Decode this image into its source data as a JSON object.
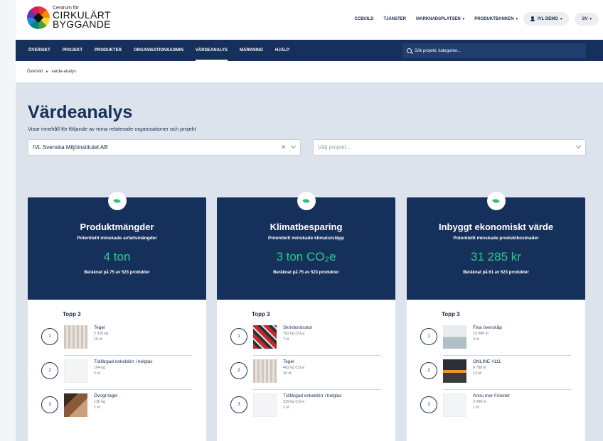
{
  "header": {
    "logo": {
      "line1": "Centrum för",
      "line2": "CIRKULÄRT",
      "line3": "BYGGANDE"
    },
    "nav": [
      {
        "label": "CCBUILD",
        "caret": ""
      },
      {
        "label": "TJÄNSTER",
        "caret": ""
      },
      {
        "label": "MARKNADSPLATSEN",
        "caret": "▾"
      },
      {
        "label": "PRODUKTBANKEN",
        "caret": "▾"
      }
    ],
    "user_label": "IVL DEMO",
    "lang_label": "SV",
    "caret": "▾"
  },
  "mainnav": {
    "items": [
      "ÖVERSIKT",
      "PROJEKT",
      "PRODUKTER",
      "ORGANISATIONSADMIN",
      "VÄRDEANALYS",
      "MÄRKNING",
      "HJÄLP"
    ],
    "active_index": 4,
    "search_placeholder": "Sök projekt, kategorier..."
  },
  "breadcrumb": {
    "items": [
      "Översikt",
      "varde-analys"
    ],
    "separator": "▸"
  },
  "page": {
    "title": "Värdeanalys",
    "subtitle": "Visar innehåll för följande av mina relaterade organisationer och projekt",
    "org_select": {
      "value": "IVL Svenska Miljöinstitutet AB",
      "clear": "✕"
    },
    "project_select": {
      "placeholder": "Välj projekt..."
    }
  },
  "cards": [
    {
      "title": "Produktmängder",
      "subtitle": "Potentiellt minskade avfallsmängder",
      "value": "4 ton",
      "note": "Beräknat på 75 av 523 produkter",
      "topp_label": "Topp 3",
      "items": [
        {
          "rank": "1",
          "name": "Tegel",
          "m1": "2 310 kg",
          "m2": "16 st",
          "thumb": "tegel"
        },
        {
          "rank": "2",
          "name": "Träfärgad enkeldörr i helglas",
          "m1": "164 kg",
          "m2": "2 st",
          "thumb": "placeholder"
        },
        {
          "rank": "3",
          "name": "Övrigt tegel",
          "m1": "136 kg",
          "m2": "1 st",
          "thumb": "ovrigt"
        }
      ]
    },
    {
      "title": "Klimatbesparing",
      "subtitle": "Potentiellt minskade klimatutsläpp",
      "value": "3 ton CO₂e",
      "note": "Beräknat på 75 av 523 produkter",
      "topp_label": "Topp 3",
      "items": [
        {
          "rank": "1",
          "name": "Skrivbordsstol",
          "m1": "762 kg CO₂e",
          "m2": "7 st",
          "thumb": "chair"
        },
        {
          "rank": "2",
          "name": "Tegel",
          "m1": "462 kg CO₂e",
          "m2": "16 st",
          "thumb": "tegel"
        },
        {
          "rank": "3",
          "name": "Träfärgad enkeldörr i helglas",
          "m1": "329 kg CO₂e",
          "m2": "2 st",
          "thumb": "placeholder"
        }
      ]
    },
    {
      "title": "Inbyggt ekonomiskt värde",
      "subtitle": "Potentiellt minskade produktkostnader",
      "value": "31 285 kr",
      "note": "Beräknat på 61 av 523 produkter",
      "topp_label": "Topp 3",
      "items": [
        {
          "rank": "1",
          "name": "Fina överskåp",
          "m1": "15 000 kr",
          "m2": "3 st",
          "thumb": "overskap"
        },
        {
          "rank": "2",
          "name": "ONLINE #111",
          "m1": "8 788 kr",
          "m2": "13 st",
          "thumb": "online"
        },
        {
          "rank": "3",
          "name": "Ännu mer Fönster",
          "m1": "3 098 kr",
          "m2": "1 st",
          "thumb": "placeholder"
        }
      ]
    }
  ]
}
